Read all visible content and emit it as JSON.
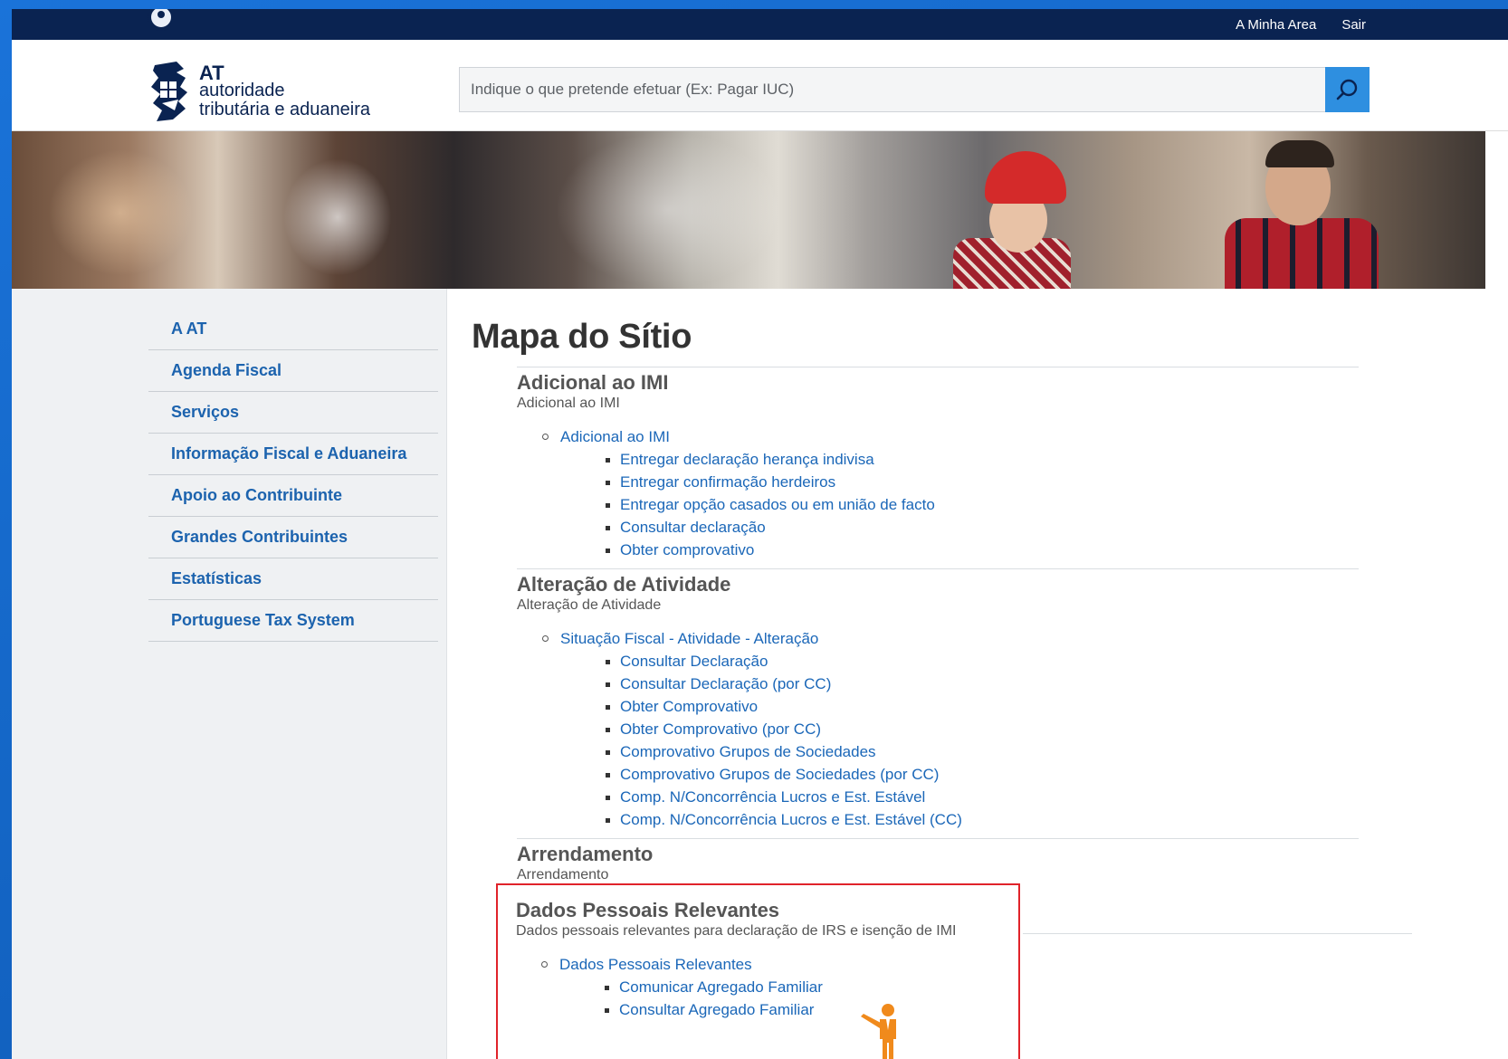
{
  "topbar": {
    "links": [
      "A Minha Area",
      "Sair"
    ]
  },
  "header": {
    "logo": {
      "line1": "AT",
      "line2": "autoridade",
      "line3": "tributária e aduaneira"
    },
    "search": {
      "placeholder": "Indique o que pretende efetuar (Ex: Pagar IUC)",
      "value": ""
    }
  },
  "sidebar": {
    "items": [
      "A AT",
      "Agenda Fiscal",
      "Serviços",
      "Informação Fiscal e Aduaneira",
      "Apoio ao Contribuinte",
      "Grandes Contribuintes",
      "Estatísticas",
      "Portuguese Tax System"
    ]
  },
  "main": {
    "title": "Mapa do Sítio",
    "sections": [
      {
        "heading": "Adicional ao IMI",
        "subtitle": "Adicional ao IMI",
        "group": "Adicional ao IMI",
        "items": [
          "Entregar declaração herança indivisa",
          "Entregar confirmação herdeiros",
          "Entregar opção casados ou em união de facto",
          "Consultar declaração",
          "Obter comprovativo"
        ]
      },
      {
        "heading": "Alteração de Atividade",
        "subtitle": "Alteração de Atividade",
        "group": "Situação Fiscal - Atividade - Alteração",
        "items": [
          "Consultar Declaração",
          "Consultar Declaração (por CC)",
          "Obter Comprovativo",
          "Obter Comprovativo (por CC)",
          "Comprovativo Grupos de Sociedades",
          "Comprovativo Grupos de Sociedades (por CC)",
          "Comp. N/Concorrência Lucros e Est. Estável",
          "Comp. N/Concorrência Lucros e Est. Estável (CC)"
        ]
      },
      {
        "heading": "Arrendamento",
        "subtitle": "Arrendamento",
        "group": "",
        "items": []
      },
      {
        "heading": "Dados Pessoais Relevantes",
        "subtitle": "Dados pessoais relevantes para declaração de IRS e isenção de IMI",
        "group": "Dados Pessoais Relevantes",
        "items": [
          "Comunicar Agregado Familiar",
          "Consultar Agregado Familiar"
        ]
      }
    ]
  },
  "colors": {
    "topbar": "#0a2351",
    "link": "#1b67b8",
    "sidebar_link": "#1c63ae",
    "search_button": "#2e8fe0",
    "highlight_box": "#e0232a",
    "presenter_icon": "#f08a1c"
  },
  "icons": [
    "user-icon",
    "at-logo-icon",
    "search-icon",
    "presenter-icon"
  ]
}
